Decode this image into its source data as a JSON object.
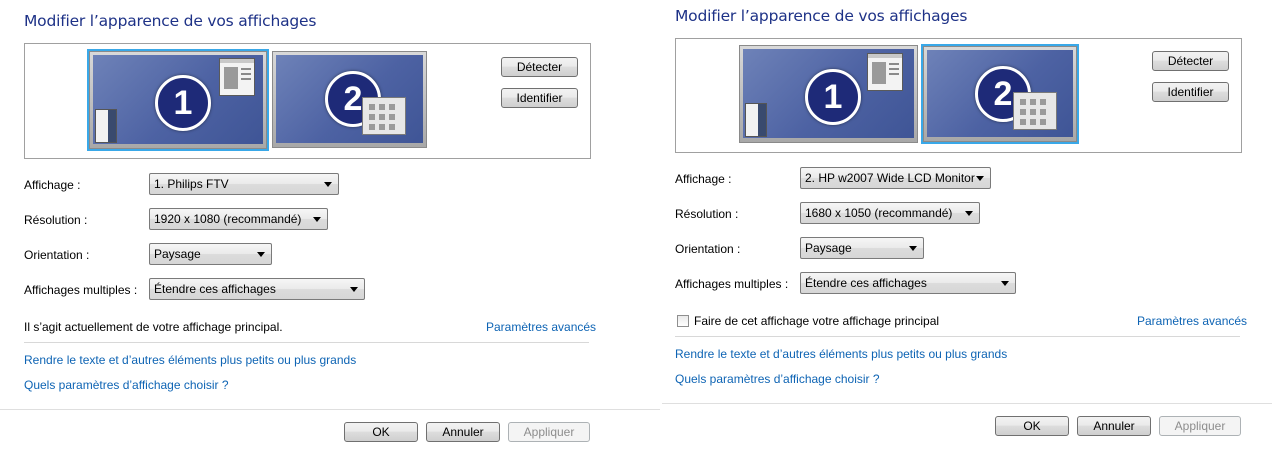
{
  "left": {
    "title": "Modifier l’apparence de vos affichages",
    "detect_label": "Détecter",
    "identify_label": "Identifier",
    "monitor1": "1",
    "monitor2": "2",
    "display_label": "Affichage :",
    "display_value": "1. Philips FTV",
    "resolution_label": "Résolution :",
    "resolution_value": "1920 x 1080 (recommandé)",
    "orientation_label": "Orientation :",
    "orientation_value": "Paysage",
    "multiple_label": "Affichages multiples :",
    "multiple_value": "Étendre ces affichages",
    "primary_text": "Il s’agit actuellement de votre affichage principal.",
    "advanced_link": "Paramètres avancés",
    "link_text_size": "Rendre le texte et d’autres éléments plus petits ou plus grands",
    "link_which_settings": "Quels paramètres d’affichage choisir ?",
    "ok_label": "OK",
    "cancel_label": "Annuler",
    "apply_label": "Appliquer"
  },
  "right": {
    "title": "Modifier l’apparence de vos affichages",
    "detect_label": "Détecter",
    "identify_label": "Identifier",
    "monitor1": "1",
    "monitor2": "2",
    "display_label": "Affichage :",
    "display_value": "2. HP w2007 Wide LCD Monitor",
    "resolution_label": "Résolution :",
    "resolution_value": "1680 x 1050 (recommandé)",
    "orientation_label": "Orientation :",
    "orientation_value": "Paysage",
    "multiple_label": "Affichages multiples :",
    "multiple_value": "Étendre ces affichages",
    "primary_checkbox_label": "Faire de cet affichage votre affichage principal",
    "primary_checked": false,
    "advanced_link": "Paramètres avancés",
    "link_text_size": "Rendre le texte et d’autres éléments plus petits ou plus grands",
    "link_which_settings": "Quels paramètres d’affichage choisir ?",
    "ok_label": "OK",
    "cancel_label": "Annuler",
    "apply_label": "Appliquer"
  },
  "colors": {
    "title": "#1e3287",
    "link": "#0e64b4",
    "selection": "#39a8e8"
  }
}
